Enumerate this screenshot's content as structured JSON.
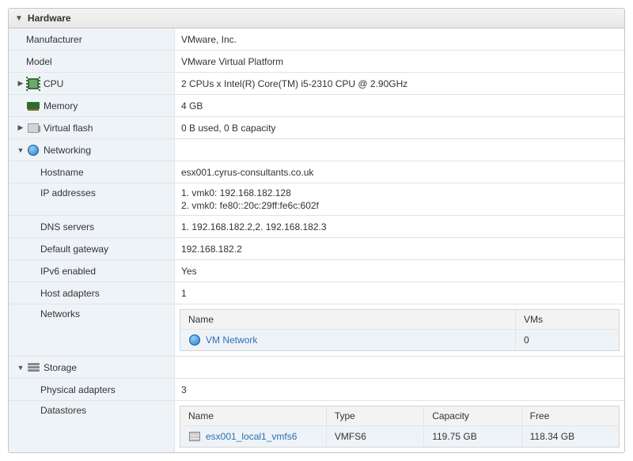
{
  "panel": {
    "title": "Hardware"
  },
  "rows": {
    "manufacturer": {
      "label": "Manufacturer",
      "value": "VMware, Inc."
    },
    "model": {
      "label": "Model",
      "value": "VMware Virtual Platform"
    },
    "cpu": {
      "label": "CPU",
      "value": "2 CPUs x Intel(R) Core(TM) i5-2310 CPU @ 2.90GHz"
    },
    "memory": {
      "label": "Memory",
      "value": "4 GB"
    },
    "virtual_flash": {
      "label": "Virtual flash",
      "value": "0 B used, 0 B capacity"
    },
    "networking": {
      "label": "Networking"
    },
    "hostname": {
      "label": "Hostname",
      "value": "esx001.cyrus-consultants.co.uk"
    },
    "ip_addresses": {
      "label": "IP addresses",
      "line1": "1. vmk0: 192.168.182.128",
      "line2": "2. vmk0: fe80::20c:29ff:fe6c:602f"
    },
    "dns_servers": {
      "label": "DNS servers",
      "value": "1. 192.168.182.2,2. 192.168.182.3"
    },
    "default_gateway": {
      "label": "Default gateway",
      "value": "192.168.182.2"
    },
    "ipv6_enabled": {
      "label": "IPv6 enabled",
      "value": "Yes"
    },
    "host_adapters": {
      "label": "Host adapters",
      "value": "1"
    },
    "networks": {
      "label": "Networks"
    },
    "storage": {
      "label": "Storage"
    },
    "physical_adapters": {
      "label": "Physical adapters",
      "value": "3"
    },
    "datastores": {
      "label": "Datastores"
    }
  },
  "networks_table": {
    "headers": {
      "name": "Name",
      "vms": "VMs"
    },
    "row": {
      "name": "VM Network",
      "vms": "0"
    }
  },
  "datastores_table": {
    "headers": {
      "name": "Name",
      "type": "Type",
      "capacity": "Capacity",
      "free": "Free"
    },
    "row": {
      "name": "esx001_local1_vmfs6",
      "type": "VMFS6",
      "capacity": "119.75 GB",
      "free": "118.34 GB"
    }
  }
}
